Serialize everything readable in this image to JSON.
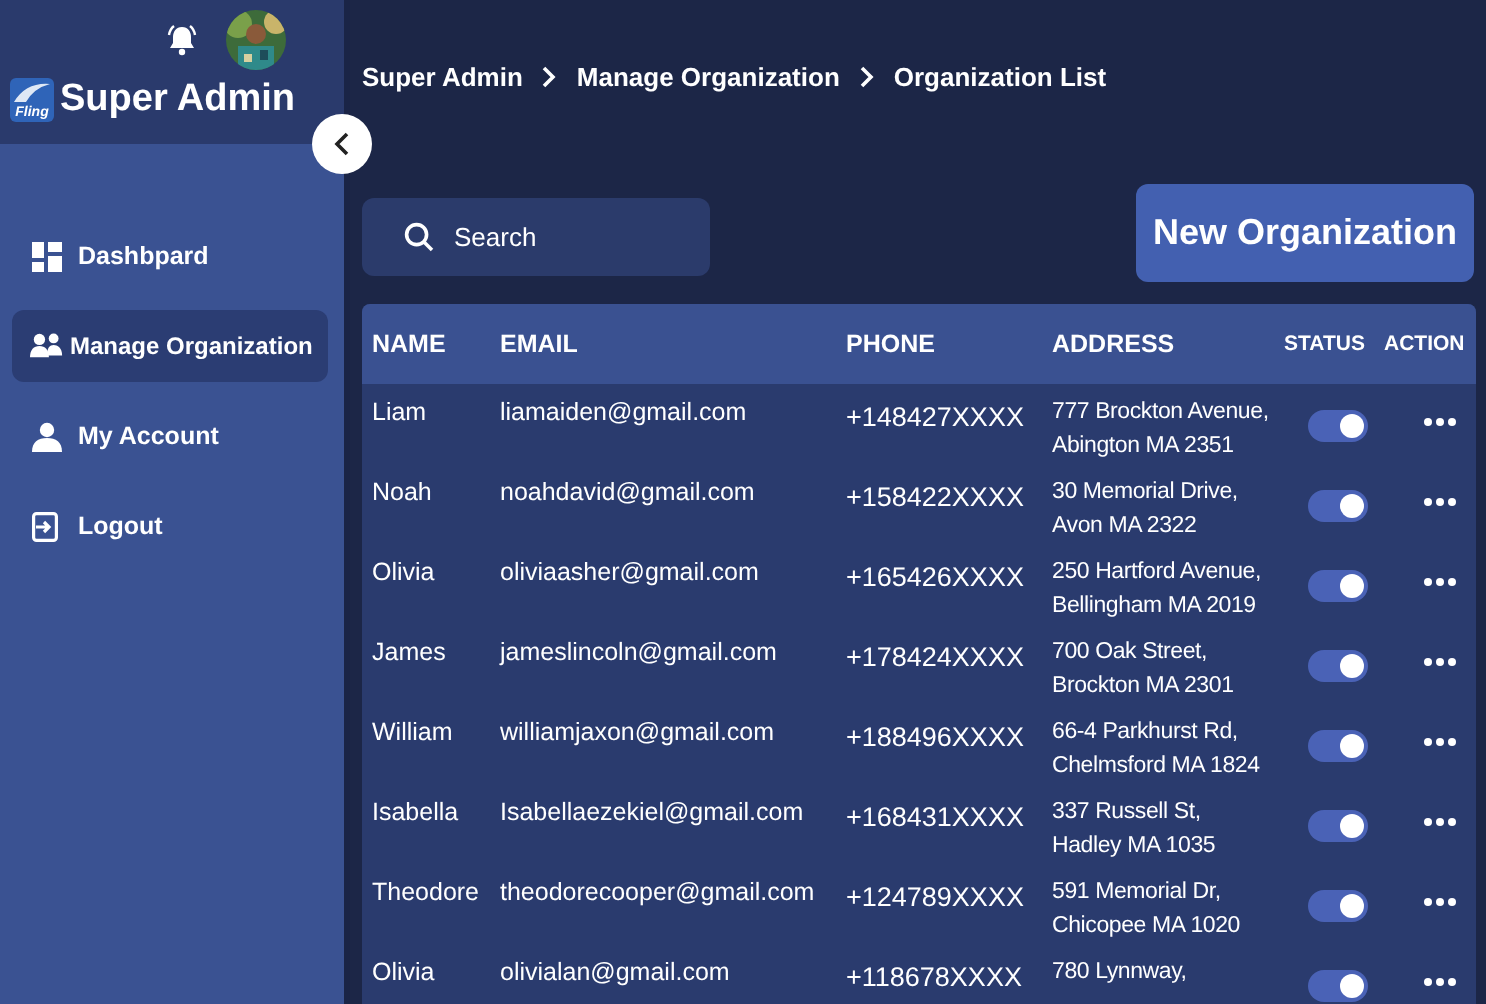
{
  "sidebar": {
    "logo_text": "Fling",
    "title": "Super Admin",
    "items": [
      {
        "label": "Dashbpard",
        "kind": "dashboard",
        "selected": false
      },
      {
        "label": "Manage Organization",
        "kind": "group",
        "selected": true
      },
      {
        "label": "My Account",
        "kind": "person",
        "selected": false
      },
      {
        "label": "Logout",
        "kind": "logout",
        "selected": false
      }
    ]
  },
  "breadcrumb": [
    "Super Admin",
    "Manage Organization",
    "Organization List"
  ],
  "search": {
    "placeholder": "Search"
  },
  "new_button": "New Organization",
  "table": {
    "columns": [
      "NAME",
      "EMAIL",
      "PHONE",
      "ADDRESS",
      "STATUS",
      "ACTION"
    ],
    "rows": [
      {
        "name": "Liam",
        "email": "liamaiden@gmail.com",
        "phone": "+148427XXXX",
        "address": [
          "777 Brockton Avenue,",
          "Abington MA 2351"
        ],
        "on": true
      },
      {
        "name": "Noah",
        "email": "noahdavid@gmail.com",
        "phone": "+158422XXXX",
        "address": [
          "30 Memorial Drive,",
          "Avon MA 2322"
        ],
        "on": true
      },
      {
        "name": "Olivia",
        "email": "oliviaasher@gmail.com",
        "phone": "+165426XXXX",
        "address": [
          "250 Hartford Avenue,",
          "Bellingham MA 2019"
        ],
        "on": true
      },
      {
        "name": "James",
        "email": "jameslincoln@gmail.com",
        "phone": "+178424XXXX",
        "address": [
          "700 Oak Street,",
          "Brockton MA 2301"
        ],
        "on": true
      },
      {
        "name": "William",
        "email": "williamjaxon@gmail.com",
        "phone": "+188496XXXX",
        "address": [
          "66-4 Parkhurst Rd,",
          "Chelmsford MA 1824"
        ],
        "on": true
      },
      {
        "name": "Isabella",
        "email": "Isabellaezekiel@gmail.com",
        "phone": "+168431XXXX",
        "address": [
          "337 Russell St,",
          "Hadley MA 1035"
        ],
        "on": true
      },
      {
        "name": "Theodore",
        "email": "theodorecooper@gmail.com",
        "phone": "+124789XXXX",
        "address": [
          "591 Memorial Dr,",
          "Chicopee MA 1020"
        ],
        "on": true
      },
      {
        "name": "Olivia",
        "email": "olivialan@gmail.com",
        "phone": "+118678XXXX",
        "address": [
          "780 Lynnway,"
        ],
        "on": true
      }
    ]
  }
}
